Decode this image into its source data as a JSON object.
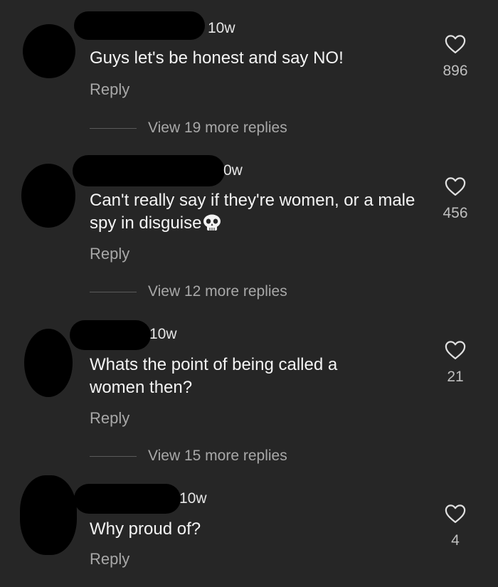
{
  "comments": [
    {
      "time": "10w",
      "text": "Guys let's be honest and say NO!",
      "reply": "Reply",
      "likes": "896",
      "view_more": "View 19 more replies"
    },
    {
      "time": "0w",
      "text": "Can't really say if they're women, or a male spy in disguise",
      "reply": "Reply",
      "likes": "456",
      "view_more": "View 12 more replies"
    },
    {
      "time": "10w",
      "text": "Whats the point of being called a women then?",
      "reply": "Reply",
      "likes": "21",
      "view_more": "View 15 more replies"
    },
    {
      "time": "10w",
      "text": "Why proud of?",
      "reply": "Reply",
      "likes": "4"
    }
  ],
  "icons": {
    "like": "heart-outline-icon",
    "emoji": "skull-emoji"
  },
  "colors": {
    "background": "#262626",
    "text": "#f4f4f4",
    "muted": "#a8a8a8"
  }
}
